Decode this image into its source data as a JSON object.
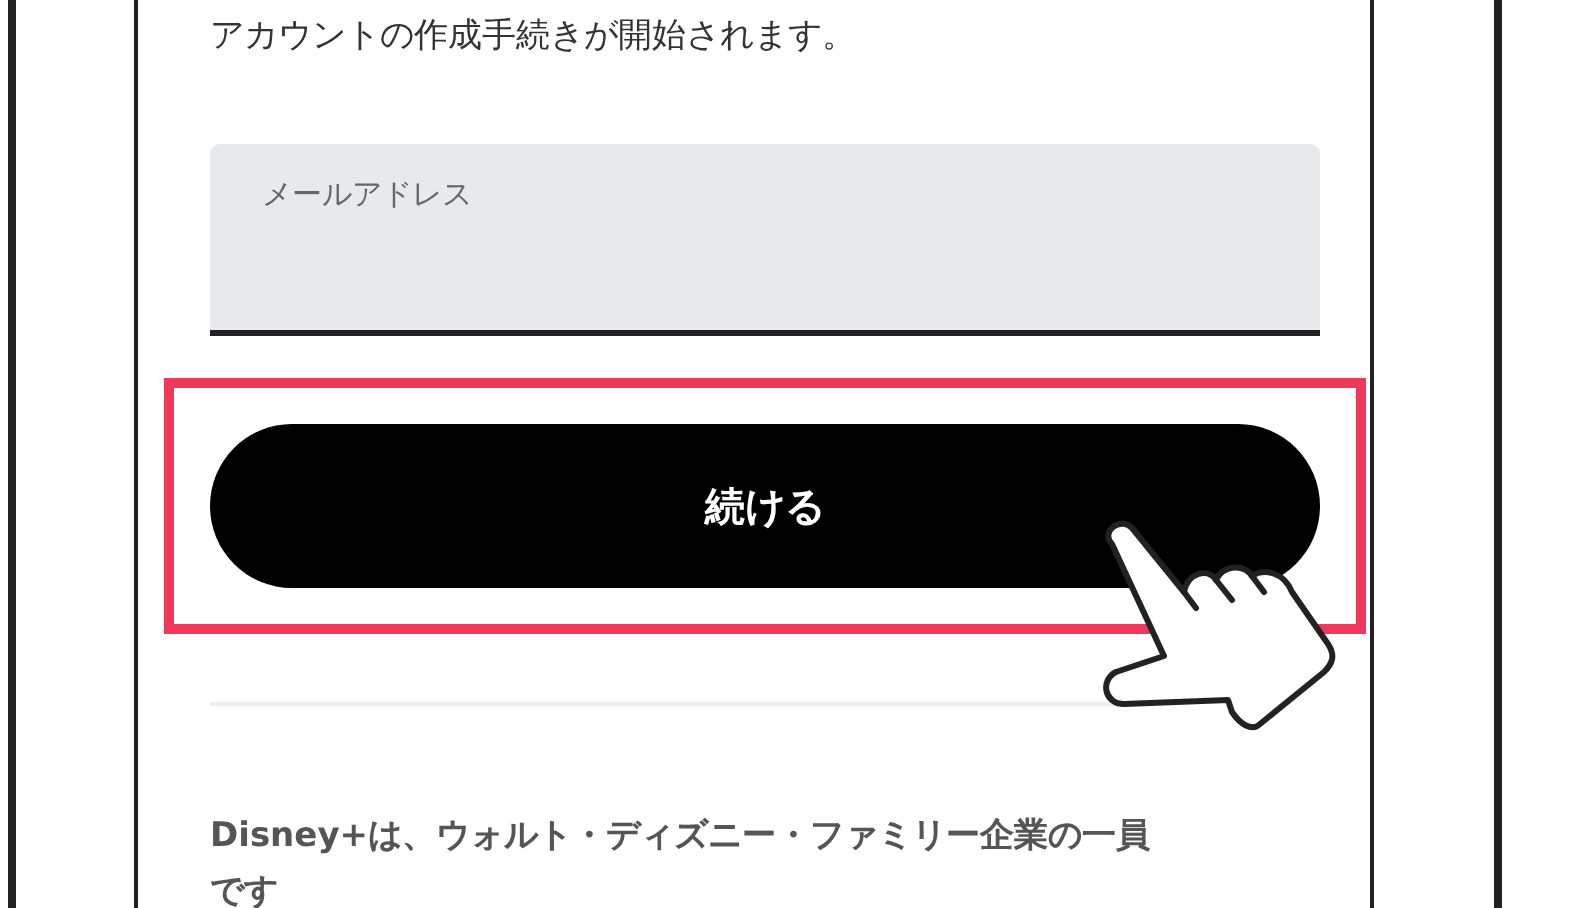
{
  "intro_text": "アカウントの作成手続きが開始されます。",
  "email_field": {
    "placeholder": "メールアドレス"
  },
  "continue_button": {
    "label": "続ける",
    "highlighted": true
  },
  "footer_text": "Disney+は、ウォルト・ディズニー・ファミリー企業の一員です"
}
